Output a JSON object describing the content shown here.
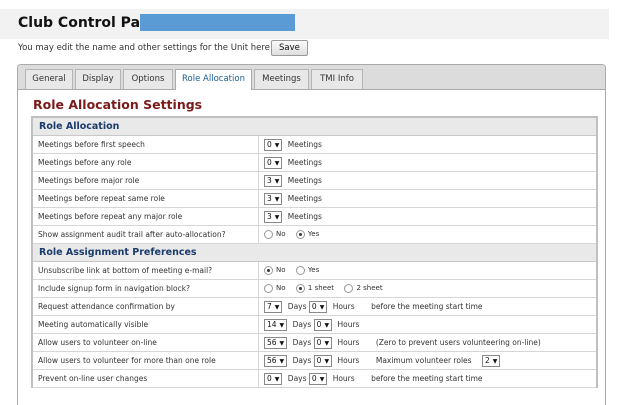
{
  "header": {
    "title": "Club Control Panel"
  },
  "hint": "You may edit the name and other settings for the Unit here",
  "save_label": "Save",
  "tabs": [
    "General",
    "Display",
    "Options",
    "Role Allocation",
    "Meetings",
    "TMI Info"
  ],
  "active_tab": "Role Allocation",
  "section_title": "Role Allocation Settings",
  "groups": {
    "allocation": "Role Allocation",
    "assignment": "Role Assignment Preferences"
  },
  "rows": {
    "first_speech": {
      "label": "Meetings before first speech",
      "value": "0",
      "unit": "Meetings"
    },
    "any_role": {
      "label": "Meetings before any role",
      "value": "0",
      "unit": "Meetings"
    },
    "major_role": {
      "label": "Meetings before major role",
      "value": "3",
      "unit": "Meetings"
    },
    "repeat_same": {
      "label": "Meetings before repeat same role",
      "value": "3",
      "unit": "Meetings"
    },
    "repeat_major": {
      "label": "Meetings before repeat any major role",
      "value": "3",
      "unit": "Meetings"
    },
    "audit_trail": {
      "label": "Show assignment audit trail after auto-allocation?",
      "opt1": "No",
      "opt2": "Yes",
      "selected": "Yes"
    },
    "unsubscribe": {
      "label": "Unsubscribe link at bottom of meeting e-mail?",
      "opt1": "No",
      "opt2": "Yes",
      "selected": "No"
    },
    "signup_form": {
      "label": "Include signup form in navigation block?",
      "opt1": "No",
      "opt2": "1 sheet",
      "opt3": "2 sheet",
      "selected": "1 sheet"
    },
    "attendance": {
      "label": "Request attendance confirmation by",
      "days": "7",
      "days_unit": "Days",
      "hours": "0",
      "hours_unit": "Hours",
      "note": "before the meeting start time"
    },
    "visible": {
      "label": "Meeting automatically visible",
      "days": "14",
      "days_unit": "Days",
      "hours": "0",
      "hours_unit": "Hours",
      "note": ""
    },
    "volunteer": {
      "label": "Allow users to volunteer on-line",
      "days": "56",
      "days_unit": "Days",
      "hours": "0",
      "hours_unit": "Hours",
      "note": "(Zero to prevent users volunteering on-line)"
    },
    "multi_volunteer": {
      "label": "Allow users to volunteer for more than one role",
      "days": "56",
      "days_unit": "Days",
      "hours": "0",
      "hours_unit": "Hours",
      "note": "Maximum volunteer roles",
      "max": "2"
    },
    "prevent_changes": {
      "label": "Prevent on-line user changes",
      "days": "0",
      "days_unit": "Days",
      "hours": "0",
      "hours_unit": "Hours",
      "note": "before the meeting start time"
    }
  },
  "colors": {
    "accent": "#5b9bd5",
    "section_title": "#7a1a1a",
    "group_title": "#1a3b6b",
    "active_tab_text": "#1a5d94"
  },
  "icons": {
    "select_arrow": "chevron-down-icon"
  }
}
